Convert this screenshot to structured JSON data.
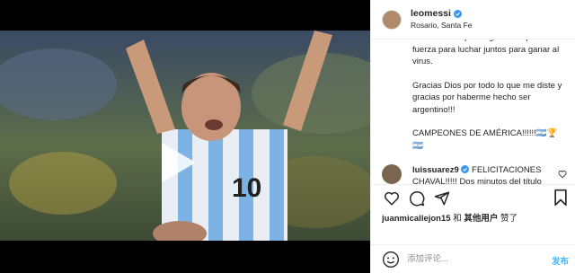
{
  "post": {
    "username": "leomessi",
    "location": "Rosario, Santa Fe",
    "caption_paragraphs": [
      "esta felicidad para agarrar un poco de fuerza para luchar juntos para ganar al virus.",
      "Gracias Dios por todo lo que me diste y gracias por haberme hecho ser argentino!!!",
      "CAMPEONES DE AMÉRICA!!!!!!🇦🇷🏆🇦🇷"
    ],
    "comment": {
      "username": "luissuarez9",
      "text": "FELICITACIONES CHAVAL!!!!! Dos minutos del título para la cerca"
    },
    "likes": {
      "user": "juanmicallejon15",
      "connector": "和",
      "others": "其他用户",
      "suffix": "赞了"
    },
    "composer": {
      "placeholder": "添加评论...",
      "post_label": "发布"
    }
  },
  "colors": {
    "accent": "#0095f6",
    "verified": "#3897f0",
    "border": "#efefef"
  },
  "icons": [
    "verified-badge-icon",
    "play-icon",
    "user-tag-icon",
    "volume-off-icon",
    "heart-icon",
    "comment-icon",
    "share-icon",
    "save-icon",
    "emoji-icon"
  ]
}
